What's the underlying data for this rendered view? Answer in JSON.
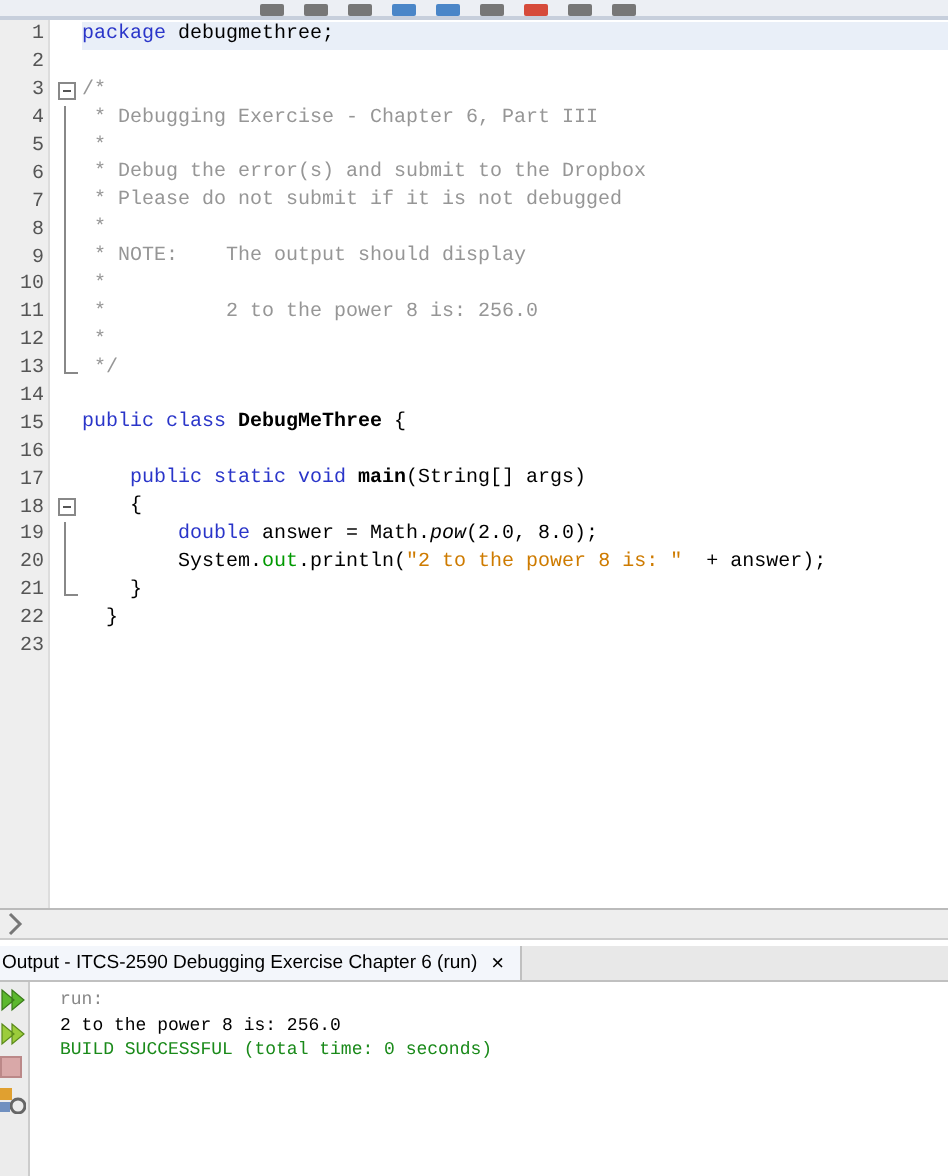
{
  "editor": {
    "lines": [
      {
        "number": "1",
        "selected": true,
        "kind": "code",
        "tokens": [
          {
            "kind": "keyword",
            "text": "package"
          },
          {
            "kind": "plain",
            "text": " debugmethree;"
          }
        ]
      },
      {
        "number": "2",
        "selected": false,
        "kind": "code"
      },
      {
        "number": "3",
        "selected": false,
        "kind": "fold-start",
        "tokens": [
          {
            "kind": "comment",
            "text": "/*"
          }
        ]
      },
      {
        "number": "4",
        "selected": false,
        "kind": "fold-body",
        "tokens": [
          {
            "kind": "comment",
            "text": " * Debugging Exercise - Chapter 6, Part III"
          }
        ]
      },
      {
        "number": "5",
        "selected": false,
        "kind": "fold-body",
        "tokens": [
          {
            "kind": "comment",
            "text": " *"
          }
        ]
      },
      {
        "number": "6",
        "selected": false,
        "kind": "fold-body",
        "tokens": [
          {
            "kind": "comment",
            "text": " * Debug the error(s) and submit to the Dropbox"
          }
        ]
      },
      {
        "number": "7",
        "selected": false,
        "kind": "fold-body",
        "tokens": [
          {
            "kind": "comment",
            "text": " * Please do not submit if it is not debugged"
          }
        ]
      },
      {
        "number": "8",
        "selected": false,
        "kind": "fold-body",
        "tokens": [
          {
            "kind": "comment",
            "text": " *"
          }
        ]
      },
      {
        "number": "9",
        "selected": false,
        "kind": "fold-body",
        "tokens": [
          {
            "kind": "comment",
            "text": " * NOTE:    The output should display"
          }
        ]
      },
      {
        "number": "10",
        "selected": false,
        "kind": "fold-body",
        "tokens": [
          {
            "kind": "comment",
            "text": " *"
          }
        ]
      },
      {
        "number": "11",
        "selected": false,
        "kind": "fold-body",
        "tokens": [
          {
            "kind": "comment",
            "text": " *          2 to the power 8 is: 256.0"
          }
        ]
      },
      {
        "number": "12",
        "selected": false,
        "kind": "fold-body",
        "tokens": [
          {
            "kind": "comment",
            "text": " *"
          }
        ]
      },
      {
        "number": "13",
        "selected": false,
        "kind": "fold-end",
        "tokens": [
          {
            "kind": "comment",
            "text": " */"
          }
        ]
      },
      {
        "number": "14",
        "selected": false,
        "kind": "code"
      },
      {
        "number": "15",
        "selected": false,
        "kind": "code",
        "tokens": [
          {
            "kind": "keyword",
            "text": "public class "
          },
          {
            "kind": "bold",
            "text": "DebugMeThree"
          },
          {
            "kind": "plain",
            "text": " {"
          }
        ]
      },
      {
        "number": "16",
        "selected": false,
        "kind": "code"
      },
      {
        "number": "17",
        "selected": false,
        "kind": "code",
        "tokens": [
          {
            "kind": "keyword",
            "text": "    public static void "
          },
          {
            "kind": "bold",
            "text": "main"
          },
          {
            "kind": "plain",
            "text": "(String[] args)"
          }
        ]
      },
      {
        "number": "18",
        "selected": false,
        "kind": "fold-start",
        "tokens": [
          {
            "kind": "plain",
            "text": "    {"
          }
        ]
      },
      {
        "number": "19",
        "selected": false,
        "kind": "fold-body",
        "tokens": [
          {
            "kind": "keyword",
            "text": "        double"
          },
          {
            "kind": "plain",
            "text": " answer = Math."
          },
          {
            "kind": "italic",
            "text": "pow"
          },
          {
            "kind": "plain",
            "text": "(2.0, 8.0);"
          }
        ]
      },
      {
        "number": "20",
        "selected": false,
        "kind": "fold-body",
        "tokens": [
          {
            "kind": "plain",
            "text": "        System."
          },
          {
            "kind": "field",
            "text": "out"
          },
          {
            "kind": "plain",
            "text": ".println("
          },
          {
            "kind": "string",
            "text": "\"2 to the power 8 is: \""
          },
          {
            "kind": "plain",
            "text": "  + answer);"
          }
        ]
      },
      {
        "number": "21",
        "selected": false,
        "kind": "fold-end",
        "tokens": [
          {
            "kind": "plain",
            "text": "    }"
          }
        ]
      },
      {
        "number": "22",
        "selected": false,
        "kind": "code",
        "tokens": [
          {
            "kind": "plain",
            "text": "  }"
          }
        ]
      },
      {
        "number": "23",
        "selected": false,
        "kind": "code"
      }
    ]
  },
  "output": {
    "tab": {
      "title": "Output - ITCS-2590 Debugging Exercise Chapter 6 (run)",
      "close": "×",
      "selected": true
    },
    "lines": [
      {
        "kind": "info",
        "text": "run:"
      },
      {
        "kind": "out",
        "text": "2 to the power 8 is: 256.0"
      },
      {
        "kind": "success",
        "text": "BUILD SUCCESSFUL (total time: 0 seconds)"
      }
    ]
  }
}
